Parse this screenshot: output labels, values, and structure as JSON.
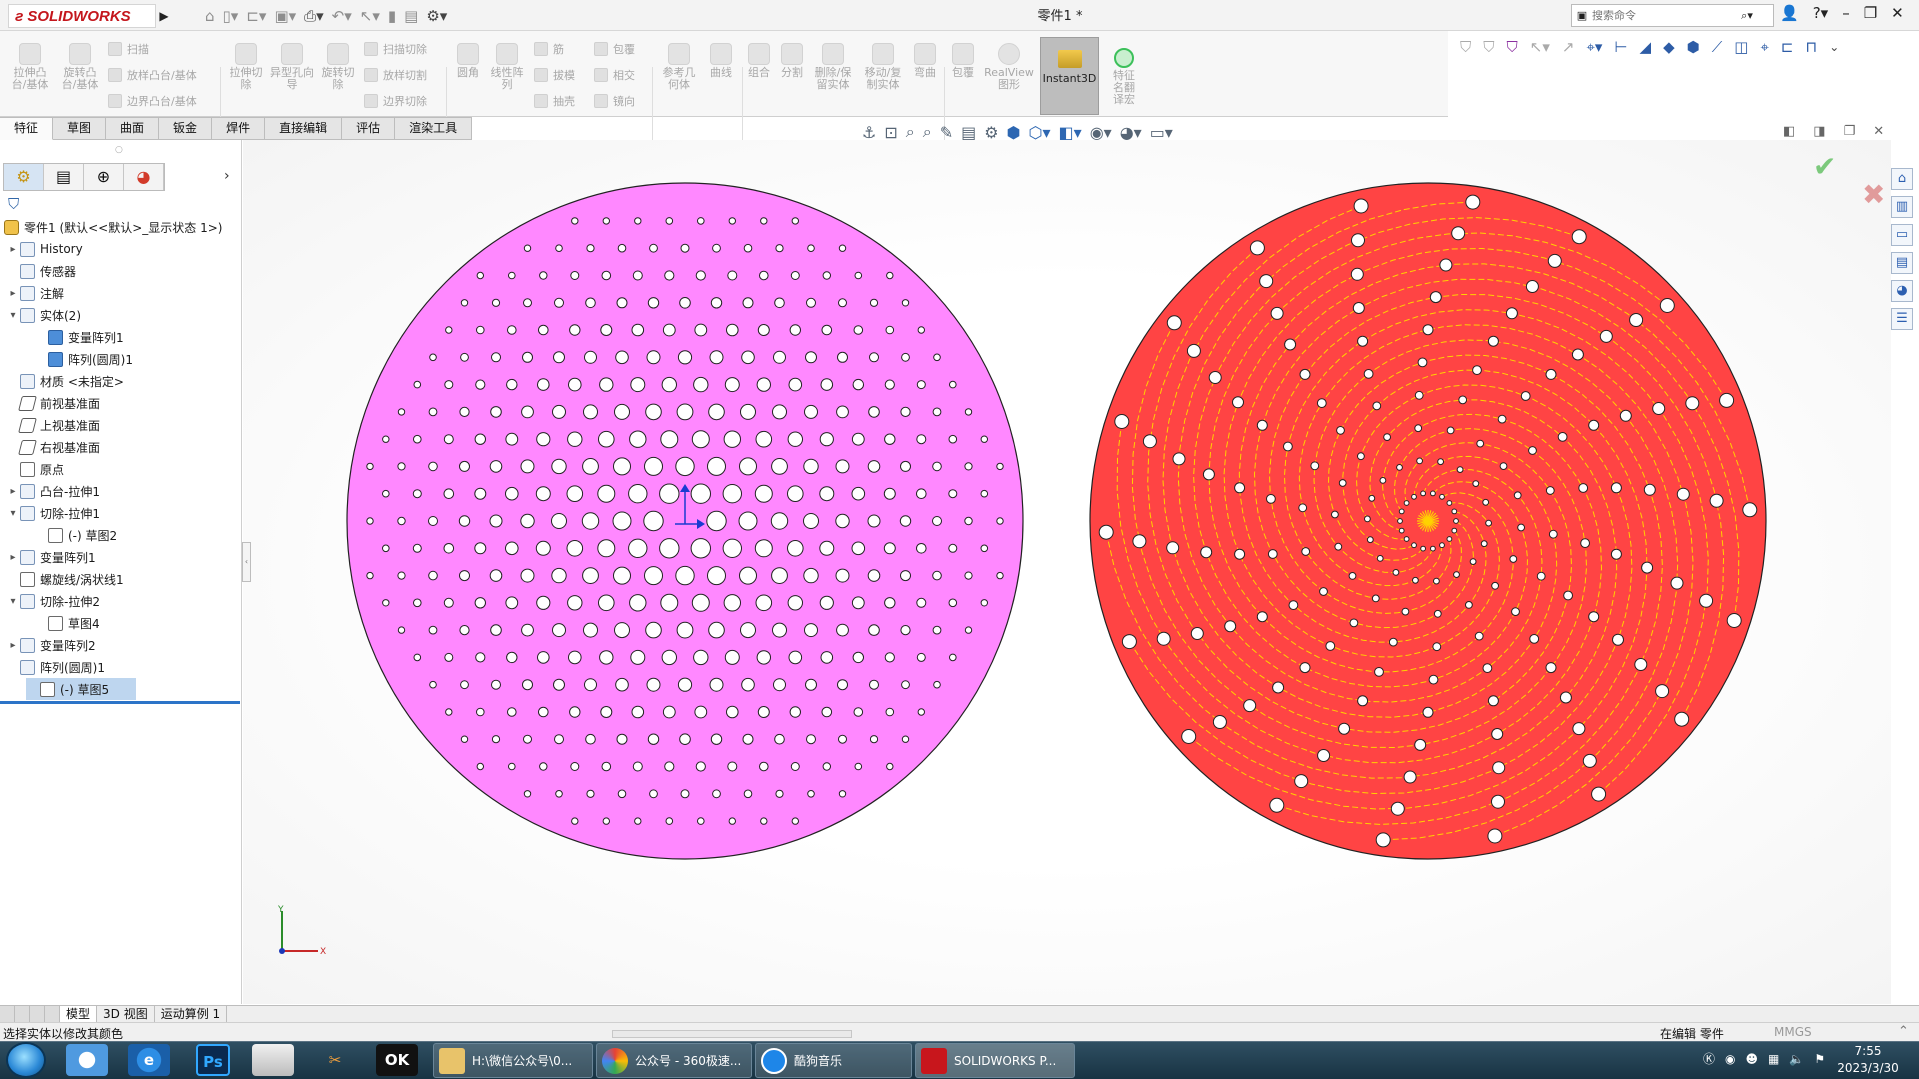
{
  "app": {
    "logo_text": "SOLIDWORKS",
    "doc_title": "零件1 *",
    "colors": {
      "brand_red": "#c4161c",
      "selection_blue": "#2c74c8",
      "left_part_fill": "#ff88ff",
      "right_part_fill": "#ff4444",
      "spiral_yellow": "#ffd200"
    }
  },
  "search": {
    "placeholder": "搜索命令"
  },
  "titlebar": {
    "icons": [
      "home-icon",
      "new-icon",
      "open-icon",
      "save-icon",
      "print-icon",
      "undo-icon",
      "select-icon",
      "rebuild-icon",
      "file-properties-icon",
      "options-icon"
    ],
    "win_buttons": [
      "user-icon",
      "help-icon",
      "minimize-icon",
      "restore-icon",
      "close-icon"
    ]
  },
  "ribbon": {
    "b1": "拉伸凸台/基体",
    "b2": "旋转凸台/基体",
    "s1": "扫描",
    "s2": "放样凸台/基体",
    "s3": "边界凸台/基体",
    "b3": "拉伸切除",
    "b4": "异型孔向导",
    "b5": "旋转切除",
    "s4": "扫描切除",
    "s5": "放样切割",
    "s6": "边界切除",
    "b6": "圆角",
    "b7": "线性阵列",
    "s7": "筋",
    "s8": "拔模",
    "s9": "抽壳",
    "s10": "包覆",
    "s11": "相交",
    "s12": "镜向",
    "b8": "参考几何体",
    "b9": "曲线",
    "b10": "组合",
    "b11": "分割",
    "b12": "删除/保留实体",
    "b13": "移动/复制实体",
    "b14": "弯曲",
    "b15": "包覆",
    "b16": "RealView图形",
    "instant3d": "Instant3D",
    "b17": "特征名翻译宏"
  },
  "tabs": [
    "特征",
    "草图",
    "曲面",
    "钣金",
    "焊件",
    "直接编辑",
    "评估",
    "渲染工具"
  ],
  "tree": {
    "root": "零件1 (默认<<默认>_显示状态 1>)",
    "history": "History",
    "sensors": "传感器",
    "annotations": "注解",
    "solid_bodies": "实体(2)",
    "body1": "变量阵列1",
    "body2": "阵列(圆周)1",
    "material": "材质 <未指定>",
    "front_plane": "前视基准面",
    "top_plane": "上视基准面",
    "right_plane": "右视基准面",
    "origin": "原点",
    "boss_extrude": "凸台-拉伸1",
    "cut_extrude1": "切除-拉伸1",
    "sketch2": "(-) 草图2",
    "variable_pattern1": "变量阵列1",
    "helix": "螺旋线/涡状线1",
    "cut_extrude2": "切除-拉伸2",
    "sketch4": "草图4",
    "variable_pattern2": "变量阵列2",
    "circular_pattern": "阵列(圆周)1",
    "sketch5": "(-) 草图5"
  },
  "bottom_tabs": [
    "模型",
    "3D 视图",
    "运动算例 1"
  ],
  "status": {
    "message": "选择实体以修改其颜色",
    "editing": "在编辑 零件",
    "units": "MMGS"
  },
  "triad": {
    "x": "X",
    "y": "Y"
  },
  "taskbar": {
    "app1": "H:\\微信公众号\\0...",
    "app2": "公众号 - 360极速...",
    "app3": "酷狗音乐",
    "app4": "SOLIDWORKS P...",
    "time": "7:55",
    "date": "2023/3/30"
  }
}
